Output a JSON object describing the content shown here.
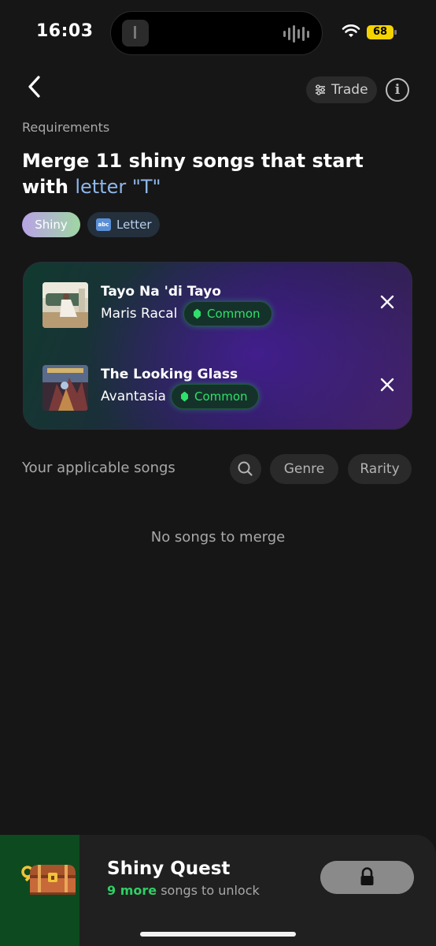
{
  "status_bar": {
    "time": "16:03",
    "battery": "68"
  },
  "header": {
    "trade_label": "Trade",
    "info_label": "i"
  },
  "requirements": {
    "label": "Requirements",
    "title_main": "Merge 11 shiny songs that start with ",
    "title_accent": "letter \"T\"",
    "chips": {
      "shiny": "Shiny",
      "letter": "Letter",
      "letter_icon": "abc"
    }
  },
  "merge_songs": [
    {
      "title": "Tayo Na 'di Tayo",
      "artist": "Maris Racal",
      "rarity": "Common"
    },
    {
      "title": "The Looking Glass",
      "artist": "Avantasia",
      "rarity": "Common"
    }
  ],
  "applicable": {
    "label": "Your applicable songs",
    "filters": {
      "genre": "Genre",
      "rarity": "Rarity"
    },
    "empty_message": "No songs to merge"
  },
  "quest": {
    "title": "Shiny Quest",
    "count_text": "9 more",
    "rest_text": " songs to unlock"
  },
  "colors": {
    "accent_blue": "#8db7ea",
    "rarity_green": "#2fe06b",
    "unlock_green": "#2fcf63",
    "background": "#161616"
  }
}
